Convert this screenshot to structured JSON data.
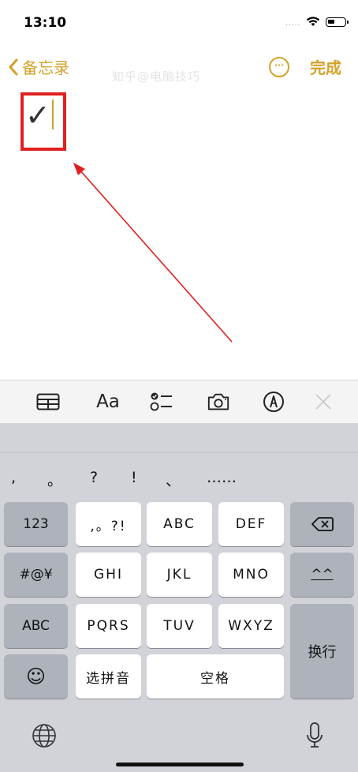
{
  "status": {
    "time": "13:10",
    "signal": "....."
  },
  "nav": {
    "back_label": "备忘录",
    "done_label": "完成",
    "more_label": "···",
    "watermark": "知乎@电脑技巧"
  },
  "note": {
    "content": "✓"
  },
  "toolbar": {
    "table_icon": "table-icon",
    "format_label": "Aa",
    "checklist_icon": "checklist-icon",
    "camera_icon": "camera-icon",
    "markup_icon": "pen-icon",
    "close_icon": "close-icon"
  },
  "keyboard": {
    "punctuation": [
      ",",
      "。",
      "?",
      "!",
      "、",
      "……"
    ],
    "keys": {
      "numbers": "123",
      "punct": ",。?!",
      "abc": "ABC",
      "def": "DEF",
      "delete": "⌫",
      "symbols": "#@¥",
      "ghi": "GHI",
      "jkl": "JKL",
      "mno": "MNO",
      "emoticon": "^^",
      "abc_mode": "ABC",
      "pqrs": "PQRS",
      "tuv": "TUV",
      "wxyz": "WXYZ",
      "return": "换行",
      "emoji": "☺",
      "pinyin": "选拼音",
      "space": "空格"
    }
  },
  "colors": {
    "accent": "#d4a12a",
    "highlight": "#e02020",
    "arrow": "#e02020"
  }
}
